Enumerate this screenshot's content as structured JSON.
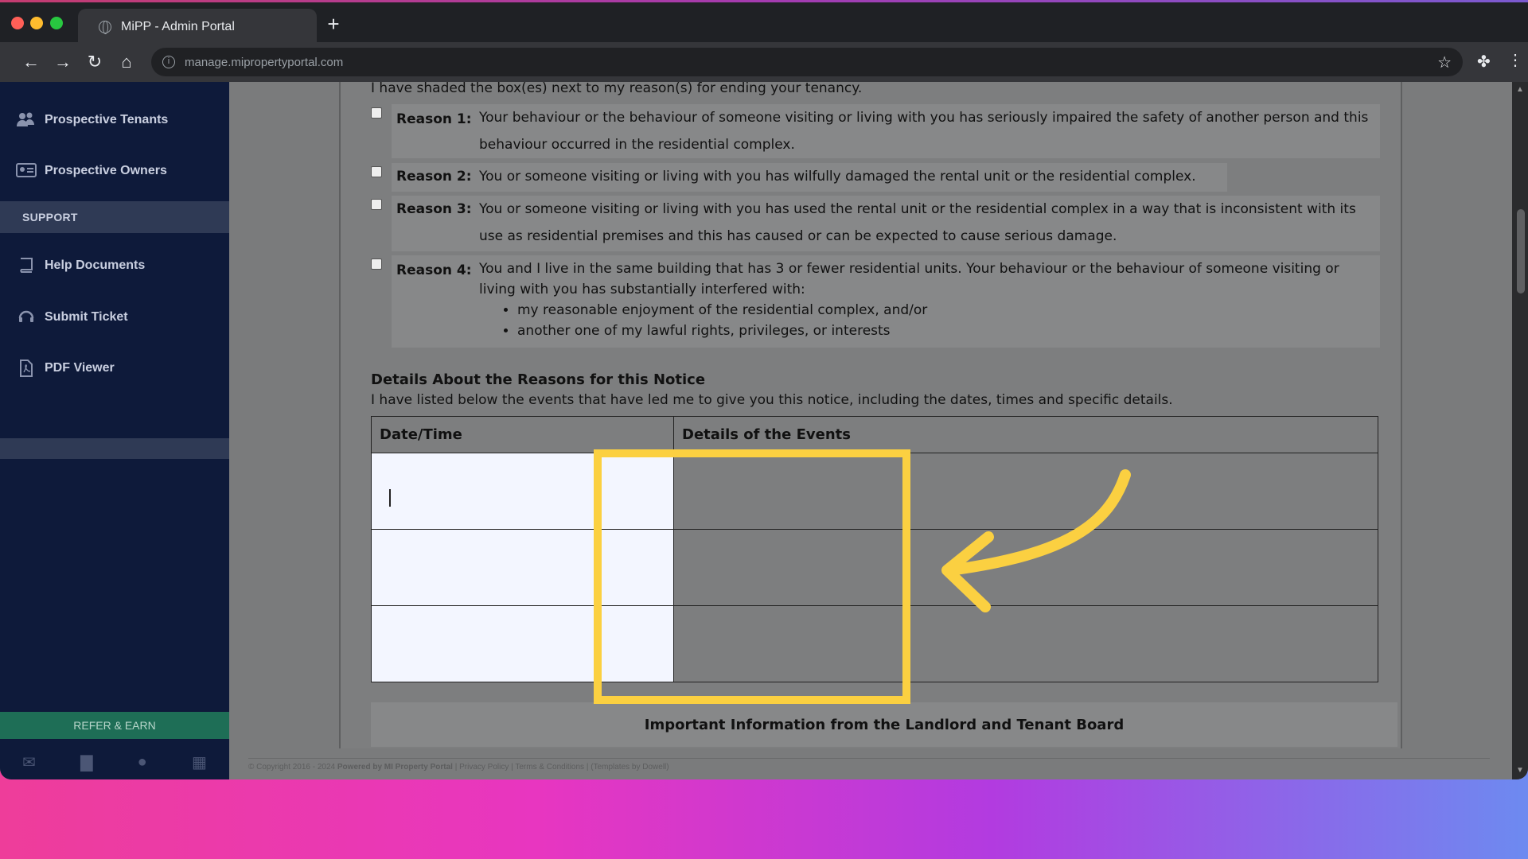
{
  "browser": {
    "tab_title": "MiPP - Admin Portal",
    "new_tab_label": "+",
    "url": "manage.mipropertyportal.com"
  },
  "sidebar": {
    "items_top": [
      {
        "label": "Prospective Tenants",
        "icon": "users-icon"
      },
      {
        "label": "Prospective Owners",
        "icon": "id-card-icon"
      }
    ],
    "support_header": "SUPPORT",
    "items_support": [
      {
        "label": "Help Documents",
        "icon": "book-icon"
      },
      {
        "label": "Submit Ticket",
        "icon": "headset-icon"
      },
      {
        "label": "PDF Viewer",
        "icon": "pdf-icon"
      }
    ],
    "refer_label": "REFER & EARN"
  },
  "document": {
    "intro": "I have shaded the box(es) next to my reason(s) for ending your tenancy.",
    "reasons": [
      {
        "label": "Reason 1:",
        "text": "Your behaviour or the behaviour of someone visiting or living with you has seriously impaired the safety of another person and this behaviour occurred in the residential complex."
      },
      {
        "label": "Reason 2:",
        "text": "You or someone visiting or living with you has wilfully damaged the rental unit or the residential complex."
      },
      {
        "label": "Reason 3:",
        "text": "You or someone visiting or living with you has used the rental unit or the residential complex in a way that is inconsistent with its use as residential premises and this has caused or can be expected to cause serious damage."
      },
      {
        "label": "Reason 4:",
        "text": "You and I live in the same building that has 3 or fewer residential units. Your behaviour or the behaviour of someone visiting or living with you has substantially interfered with:",
        "bullets": [
          "my reasonable enjoyment of the residential complex, and/or",
          "another one of my lawful rights, privileges, or interests"
        ]
      }
    ],
    "details_heading": "Details About the Reasons for this Notice",
    "details_sub": "I have listed below the events that have led me to give you this notice, including the dates, times and specific details.",
    "table_headers": [
      "Date/Time",
      "Details of the Events"
    ],
    "important_heading": "Important Information from the Landlord and Tenant Board"
  },
  "footer": {
    "copyright": "© Copyright 2016 - 2024",
    "powered": "Powered by MI Property Portal",
    "sep": "|",
    "privacy": "Privacy Policy",
    "terms": "Terms & Conditions",
    "templates": "(Templates by Dowell)"
  },
  "colors": {
    "sidebar_bg": "#0e1a3a",
    "highlight": "#fbd041",
    "refer_bg": "#1e6e56"
  }
}
